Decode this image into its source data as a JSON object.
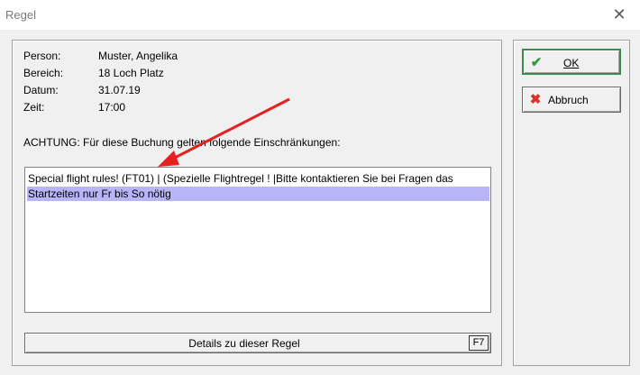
{
  "window": {
    "title": "Regel",
    "close_glyph": "✕"
  },
  "info": {
    "rows": [
      {
        "label": "Person:",
        "value": "Muster, Angelika"
      },
      {
        "label": "Bereich:",
        "value": "18 Loch Platz"
      },
      {
        "label": "Datum:",
        "value": "31.07.19"
      },
      {
        "label": "Zeit:",
        "value": "17:00"
      }
    ]
  },
  "warning": "ACHTUNG: Für diese Buchung gelten folgende Einschränkungen:",
  "restrictions": {
    "items": [
      {
        "text": "Special flight rules! (FT01) | (Spezielle Flightregel ! |Bitte kontaktieren Sie bei Fragen das",
        "selected": false
      },
      {
        "text": "Startzeiten nur Fr bis So nötig",
        "selected": true
      }
    ]
  },
  "details_button": {
    "label": "Details zu dieser Regel",
    "shortcut": "F7"
  },
  "buttons": {
    "ok_label": "OK",
    "cancel_label": "Abbruch"
  },
  "icons": {
    "ok": "checkmark-icon",
    "cancel": "x-icon"
  },
  "colors": {
    "selection": "#b7b4f7",
    "annotation_arrow": "#e81f1f",
    "ok_check": "#2c9a3c",
    "cancel_x": "#d8322a"
  }
}
